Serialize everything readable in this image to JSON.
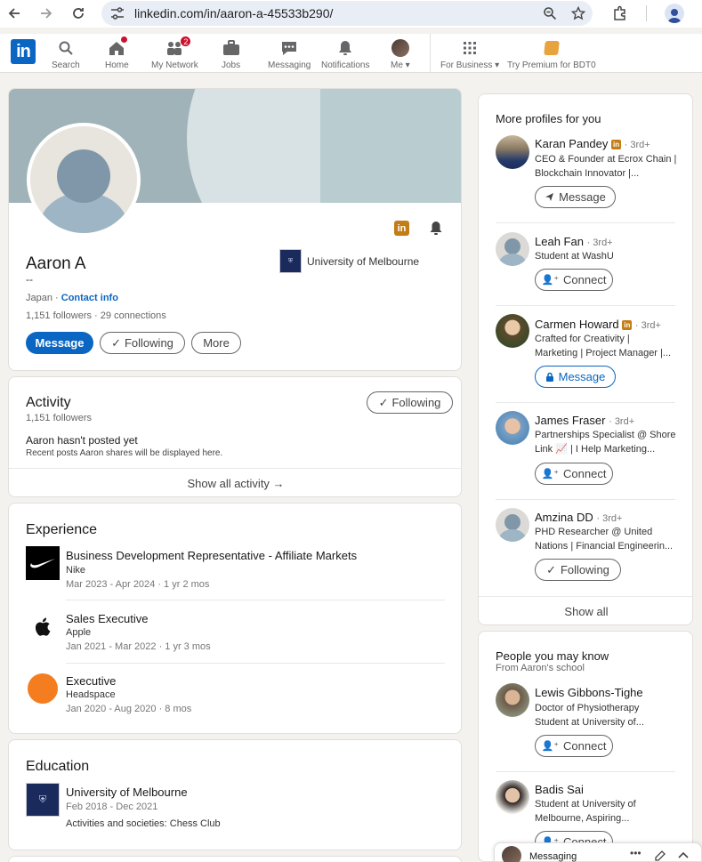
{
  "browser": {
    "url": "linkedin.com/in/aaron-a-45533b290/"
  },
  "nav": {
    "items": [
      {
        "label": "Search"
      },
      {
        "label": "Home"
      },
      {
        "label": "My Network",
        "badge": "2"
      },
      {
        "label": "Jobs"
      },
      {
        "label": "Messaging"
      },
      {
        "label": "Notifications"
      },
      {
        "label": "Me"
      },
      {
        "label": "For Business"
      },
      {
        "label": "Try Premium for BDT0"
      }
    ]
  },
  "profile": {
    "name": "Aaron A",
    "headline": "--",
    "location": "Japan",
    "contact_info": "Contact info",
    "followers": "1,151 followers",
    "connections": "29 connections",
    "school": "University of Melbourne",
    "buttons": {
      "message": "Message",
      "following": "Following",
      "more": "More"
    }
  },
  "activity": {
    "title": "Activity",
    "followers": "1,151 followers",
    "following_btn": "Following",
    "empty_title": "Aaron hasn't posted yet",
    "empty_sub": "Recent posts Aaron shares will be displayed here.",
    "show_all": "Show all activity →"
  },
  "experience": {
    "title": "Experience",
    "items": [
      {
        "title": "Business Development Representative - Affiliate Markets",
        "company": "Nike",
        "dates": "Mar 2023 - Apr 2024 · 1 yr 2 mos"
      },
      {
        "title": "Sales Executive",
        "company": "Apple",
        "dates": "Jan 2021 - Mar 2022 · 1 yr 3 mos"
      },
      {
        "title": "Executive",
        "company": "Headspace",
        "dates": "Jan 2020 - Aug 2020 · 8 mos"
      }
    ]
  },
  "education": {
    "title": "Education",
    "school": "University of Melbourne",
    "dates": "Feb 2018 - Dec 2021",
    "activities": "Activities and societies: Chess Club"
  },
  "more_profiles": {
    "title": "More profiles for you",
    "people": [
      {
        "name": "Karan Pandey",
        "degree": "· 3rd+",
        "desc1": "CEO & Founder at Ecrox Chain |",
        "desc2": "Blockchain Innovator |...",
        "button": "Message"
      },
      {
        "name": "Leah Fan",
        "degree": "· 3rd+",
        "desc1": "Student at WashU",
        "desc2": "",
        "button": "Connect"
      },
      {
        "name": "Carmen Howard",
        "degree": "· 3rd+",
        "desc1": "Crafted for Creativity |",
        "desc2": "Marketing | Project Manager |...",
        "button": "Message"
      },
      {
        "name": "James Fraser",
        "degree": "· 3rd+",
        "desc1": "Partnerships Specialist @ Shore",
        "desc2": "Link 📈 | I Help Marketing...",
        "button": "Connect"
      },
      {
        "name": "Amzina DD",
        "degree": "· 3rd+",
        "desc1": "PHD Researcher @ United",
        "desc2": "Nations | Financial Engineerin...",
        "button": "Following"
      }
    ],
    "show_all": "Show all"
  },
  "people_may_know": {
    "title": "People you may know",
    "subtitle": "From Aaron's school",
    "people": [
      {
        "name": "Lewis Gibbons-Tighe",
        "desc1": "Doctor of Physiotherapy",
        "desc2": "Student at University of...",
        "button": "Connect"
      },
      {
        "name": "Badis Sai",
        "desc1": "Student at University of",
        "desc2": "Melbourne, Aspiring...",
        "button": "Connect"
      }
    ]
  },
  "messaging_bar": {
    "label": "Messaging"
  },
  "colors": {
    "brand": "#0a66c2",
    "premium": "#c37d16",
    "badge": "#cb112d"
  }
}
